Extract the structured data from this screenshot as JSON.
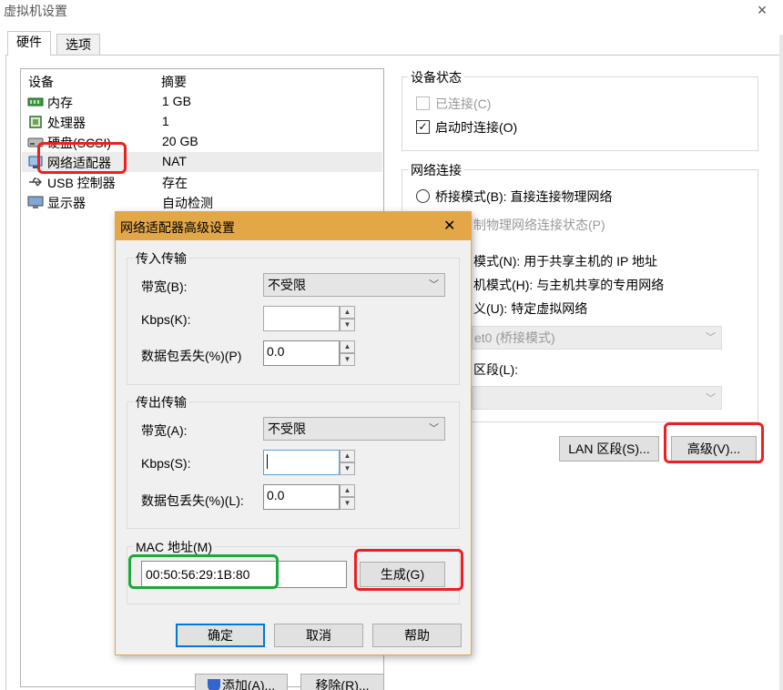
{
  "window": {
    "title": "虚拟机设置",
    "close_glyph": "×"
  },
  "tabs": [
    {
      "label": "硬件"
    },
    {
      "label": "选项"
    }
  ],
  "device_list": {
    "col_device": "设备",
    "col_summary": "摘要",
    "rows": [
      {
        "name": "内存",
        "summary": "1 GB",
        "icon": "memory-icon"
      },
      {
        "name": "处理器",
        "summary": "1",
        "icon": "processor-icon"
      },
      {
        "name": "硬盘(SCSI)",
        "summary": "20 GB",
        "icon": "hard-disk-icon"
      },
      {
        "name": "网络适配器",
        "summary": "NAT",
        "icon": "network-adapter-icon"
      },
      {
        "name": "USB 控制器",
        "summary": "存在",
        "icon": "usb-icon"
      },
      {
        "name": "显示器",
        "summary": "自动检测",
        "icon": "display-icon"
      }
    ]
  },
  "buttons_bottom": {
    "add": "添加(A)...",
    "remove": "移除(R)..."
  },
  "device_status": {
    "label": "设备状态",
    "connected": "已连接(C)",
    "connect_on_power": "启动时连接(O)"
  },
  "network": {
    "label": "网络连接",
    "bridged": "桥接模式(B): 直接连接物理网络",
    "replicate": "制物理网络连接状态(P)",
    "nat": "模式(N): 用于共享主机的 IP 地址",
    "host_only": "机模式(H): 与主机共享的专用网络",
    "custom": "(U): 特定虚拟网络",
    "custom_prefix": "义",
    "vmnet": "et0 (桥接模式)",
    "lan_seg_label": "区段(L):",
    "lan_seg_btn": "LAN 区段(S)...",
    "advanced_btn": "高级(V)..."
  },
  "dialog": {
    "title": "网络适配器高级设置",
    "close_glyph": "✕",
    "incoming": {
      "label": "传入传输",
      "bandwidth_label": "带宽(B):",
      "bandwidth": "不受限",
      "kbps_label": "Kbps(K):",
      "kbps": "",
      "loss_label": "数据包丢失(%)(P)",
      "loss": "0.0"
    },
    "outgoing": {
      "label": "传出传输",
      "bandwidth_label": "带宽(A):",
      "bandwidth": "不受限",
      "kbps_label": "Kbps(S):",
      "kbps": "",
      "loss_label": "数据包丢失(%)(L):",
      "loss": "0.0"
    },
    "mac": {
      "label": "MAC 地址(M)",
      "value": "00:50:56:29:1B:80",
      "generate": "生成(G)"
    },
    "ok": "确定",
    "cancel": "取消",
    "help": "帮助"
  },
  "colors": {
    "dialog_title_bar": "#e3a748",
    "highlight_red": "#ec2020",
    "highlight_green": "#1ca83a",
    "ok_border": "#0078d7"
  }
}
